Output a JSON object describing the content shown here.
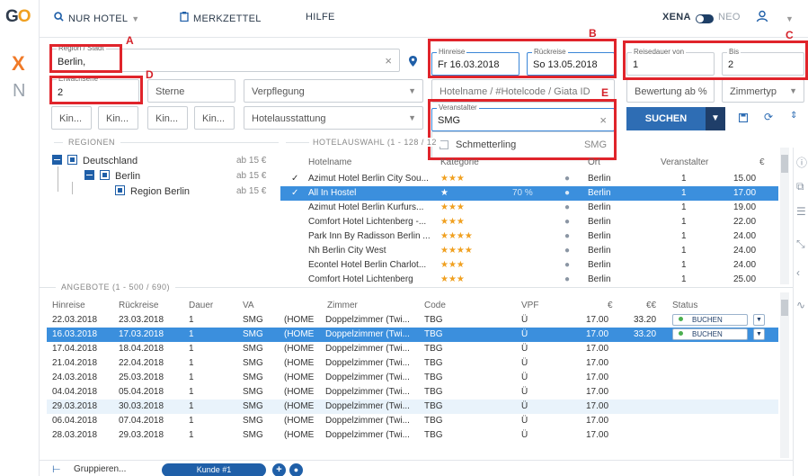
{
  "brand": {
    "logo_g": "G",
    "logo_o": "O",
    "rail_x": "X",
    "rail_n": "N"
  },
  "nav": {
    "mode": "NUR HOTEL",
    "merkzettel": "MERKZETTEL",
    "hilfe": "HILFE",
    "xena": "XENA",
    "neo": "NEO"
  },
  "search": {
    "region_label": "Region / Stadt",
    "region_value": "Berlin,",
    "erwachsene_label": "Erwachsene",
    "erwachsene_value": "2",
    "sterne_placeholder": "Sterne",
    "verpflegung_placeholder": "Verpflegung",
    "hotelname_placeholder": "Hotelname / #Hotelcode / Giata ID",
    "bewertung_placeholder": "Bewertung ab %",
    "zimmertyp_placeholder": "Zimmertyp",
    "kin1": "Kin...",
    "kin2": "Kin...",
    "kin3": "Kin...",
    "kin4": "Kin...",
    "hotelausstattung_placeholder": "Hotelausstattung",
    "hinreise_label": "Hinreise",
    "hinreise_value": "Fr 16.03.2018",
    "rueckreise_label": "Rückreise",
    "rueckreise_value": "So 13.05.2018",
    "reisedauer_label": "Reisedauer von",
    "reisedauer_value": "1",
    "bis_label": "Bis",
    "bis_value": "2",
    "veranstalter_label": "Veranstalter",
    "veranstalter_value": "SMG",
    "veranstalter_option": "Schmetterling",
    "veranstalter_option_code": "SMG",
    "search_button": "SUCHEN"
  },
  "annotations": {
    "a": "A",
    "b": "B",
    "c": "C",
    "d": "D",
    "e": "E"
  },
  "regionen": {
    "title": "REGIONEN",
    "items": [
      {
        "label": "Deutschland",
        "price": "ab 15 €"
      },
      {
        "label": "Berlin",
        "price": "ab 15 €"
      },
      {
        "label": "Region Berlin",
        "price": "ab 15 €"
      }
    ]
  },
  "hotels": {
    "title": "HOTELAUSWAHL (1 - 128 / 12",
    "headers": {
      "name": "Hotelname",
      "kat": "Kategorie",
      "ort": "Ort",
      "veranstalter": "Veranstalter",
      "preis": "€"
    },
    "rows": [
      {
        "check": "✓",
        "name": "Azimut Hotel Berlin City Sou...",
        "stars": "★★★",
        "pct": "",
        "ort": "Berlin",
        "v": "1",
        "preis": "15.00"
      },
      {
        "check": "✓",
        "name": "All In Hostel",
        "stars": "★",
        "pct": "70 %",
        "ort": "Berlin",
        "v": "1",
        "preis": "17.00"
      },
      {
        "check": "",
        "name": "Azimut Hotel Berlin Kurfurs...",
        "stars": "★★★",
        "pct": "",
        "ort": "Berlin",
        "v": "1",
        "preis": "19.00"
      },
      {
        "check": "",
        "name": "Comfort Hotel Lichtenberg -...",
        "stars": "★★★",
        "pct": "",
        "ort": "Berlin",
        "v": "1",
        "preis": "22.00"
      },
      {
        "check": "",
        "name": "Park Inn By Radisson Berlin ...",
        "stars": "★★★★",
        "pct": "",
        "ort": "Berlin",
        "v": "1",
        "preis": "24.00"
      },
      {
        "check": "",
        "name": "Nh Berlin City West",
        "stars": "★★★★",
        "pct": "",
        "ort": "Berlin",
        "v": "1",
        "preis": "24.00"
      },
      {
        "check": "",
        "name": "Econtel Hotel Berlin Charlot...",
        "stars": "★★★",
        "pct": "",
        "ort": "Berlin",
        "v": "1",
        "preis": "24.00"
      },
      {
        "check": "",
        "name": "Comfort Hotel Lichtenberg",
        "stars": "★★★",
        "pct": "",
        "ort": "Berlin",
        "v": "1",
        "preis": "25.00"
      }
    ]
  },
  "angebote": {
    "title": "ANGEBOTE (1 - 500 / 690)",
    "headers": {
      "hin": "Hinreise",
      "rueck": "Rückreise",
      "dauer": "Dauer",
      "va": "VA",
      "zimmer": "Zimmer",
      "code": "Code",
      "vpf": "VPF",
      "eur": "€",
      "eur2": "€€",
      "status": "Status"
    },
    "status_label": "BUCHEN",
    "rows": [
      {
        "hin": "22.03.2018",
        "rueck": "23.03.2018",
        "dauer": "1",
        "va": "SMG",
        "home": "(HOME",
        "zimmer": "Doppelzimmer (Twi...",
        "code": "TBG",
        "vpf": "Ü",
        "eur": "17.00",
        "eur2": "33.20"
      },
      {
        "hin": "16.03.2018",
        "rueck": "17.03.2018",
        "dauer": "1",
        "va": "SMG",
        "home": "(HOME",
        "zimmer": "Doppelzimmer (Twi...",
        "code": "TBG",
        "vpf": "Ü",
        "eur": "17.00",
        "eur2": "33.20"
      },
      {
        "hin": "17.04.2018",
        "rueck": "18.04.2018",
        "dauer": "1",
        "va": "SMG",
        "home": "(HOME",
        "zimmer": "Doppelzimmer (Twi...",
        "code": "TBG",
        "vpf": "Ü",
        "eur": "17.00",
        "eur2": ""
      },
      {
        "hin": "21.04.2018",
        "rueck": "22.04.2018",
        "dauer": "1",
        "va": "SMG",
        "home": "(HOME",
        "zimmer": "Doppelzimmer (Twi...",
        "code": "TBG",
        "vpf": "Ü",
        "eur": "17.00",
        "eur2": ""
      },
      {
        "hin": "24.03.2018",
        "rueck": "25.03.2018",
        "dauer": "1",
        "va": "SMG",
        "home": "(HOME",
        "zimmer": "Doppelzimmer (Twi...",
        "code": "TBG",
        "vpf": "Ü",
        "eur": "17.00",
        "eur2": ""
      },
      {
        "hin": "04.04.2018",
        "rueck": "05.04.2018",
        "dauer": "1",
        "va": "SMG",
        "home": "(HOME",
        "zimmer": "Doppelzimmer (Twi...",
        "code": "TBG",
        "vpf": "Ü",
        "eur": "17.00",
        "eur2": ""
      },
      {
        "hin": "29.03.2018",
        "rueck": "30.03.2018",
        "dauer": "1",
        "va": "SMG",
        "home": "(HOME",
        "zimmer": "Doppelzimmer (Twi...",
        "code": "TBG",
        "vpf": "Ü",
        "eur": "17.00",
        "eur2": ""
      },
      {
        "hin": "06.04.2018",
        "rueck": "07.04.2018",
        "dauer": "1",
        "va": "SMG",
        "home": "(HOME",
        "zimmer": "Doppelzimmer (Twi...",
        "code": "TBG",
        "vpf": "Ü",
        "eur": "17.00",
        "eur2": ""
      },
      {
        "hin": "28.03.2018",
        "rueck": "29.03.2018",
        "dauer": "1",
        "va": "SMG",
        "home": "(HOME",
        "zimmer": "Doppelzimmer (Twi...",
        "code": "TBG",
        "vpf": "Ü",
        "eur": "17.00",
        "eur2": ""
      }
    ]
  },
  "footer": {
    "gruppieren": "Gruppieren...",
    "kunde": "Kunde #1"
  },
  "colors": {
    "accent": "#2e6db4",
    "selected_row": "#3b8fdd",
    "annotation": "#e0242b",
    "star": "#f0a020"
  }
}
